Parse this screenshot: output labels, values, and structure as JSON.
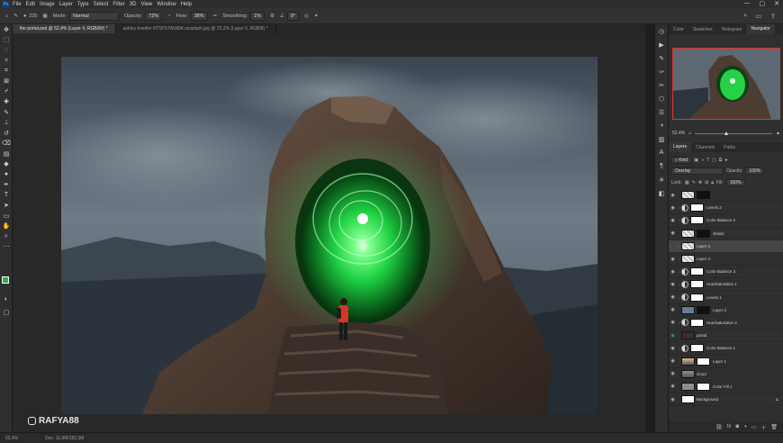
{
  "app": {
    "logo": "Ps"
  },
  "menu": [
    "File",
    "Edit",
    "Image",
    "Layer",
    "Type",
    "Select",
    "Filter",
    "3D",
    "View",
    "Window",
    "Help"
  ],
  "options": {
    "mode_label": "Mode:",
    "mode_value": "Normal",
    "opacity_label": "Opacity:",
    "opacity_value": "72%",
    "flow_label": "Flow:",
    "flow_value": "38%",
    "smoothing_label": "Smoothing:",
    "smoothing_value": "1%",
    "angle_value": "0°",
    "brush_size": "225"
  },
  "tabs": [
    {
      "label": "the portal.psd @ 52,4% (Layer 4, RGB/8#) *",
      "active": true
    },
    {
      "label": "ashley knedler 6TSPSTA5d0A unsplash.jpg @ 22,2% (Layer 0, RGB/8) *",
      "active": false
    }
  ],
  "watermark": {
    "text": "RAFYA88",
    "icon": "instagram-icon"
  },
  "status": {
    "zoom": "52,4%",
    "doc": "Doc: 11,9M/182,3M"
  },
  "panel_tabs": [
    "Color",
    "Swatches",
    "Histogram",
    "Navigator"
  ],
  "panel_tabs_active": "Navigator",
  "navigator": {
    "zoom": "52,4%"
  },
  "layers_tabs": [
    "Layers",
    "Channels",
    "Paths"
  ],
  "layers_tabs_active": "Layers",
  "layers_controls": {
    "kind": "Kind",
    "blend": "Overlay",
    "opacity_label": "Opacity:",
    "opacity_value": "100%",
    "lock_label": "Lock:",
    "fill_label": "Fill:",
    "fill_value": "100%"
  },
  "layers": [
    {
      "name": "",
      "type": "pixel",
      "mask": "dark",
      "eye": true,
      "selected": false
    },
    {
      "name": "Levels 2",
      "type": "adj",
      "mask": "light",
      "eye": true,
      "selected": false
    },
    {
      "name": "Color Balance 2",
      "type": "adj",
      "mask": "light",
      "eye": true,
      "selected": false
    },
    {
      "name": "sfskdz",
      "type": "pixel",
      "mask": "dark",
      "eye": true,
      "selected": false
    },
    {
      "name": "Layer 4",
      "type": "pixel",
      "mask": "",
      "eye": false,
      "selected": true
    },
    {
      "name": "Layer 3",
      "type": "pixel",
      "mask": "",
      "eye": true,
      "selected": false
    },
    {
      "name": "Color Balance 3",
      "type": "adj",
      "mask": "light",
      "eye": true,
      "selected": false
    },
    {
      "name": "Hue/Saturation 1",
      "type": "adj",
      "mask": "light",
      "eye": true,
      "selected": false
    },
    {
      "name": "Levels 1",
      "type": "adj",
      "mask": "light",
      "eye": true,
      "selected": false
    },
    {
      "name": "Layer 2",
      "type": "pixel",
      "mask": "dark",
      "eye": true,
      "selected": false
    },
    {
      "name": "Hue/Saturation 2",
      "type": "adj",
      "mask": "light",
      "eye": true,
      "selected": false
    },
    {
      "name": "portal",
      "type": "pixel",
      "mask": "",
      "eye": true,
      "selected": false
    },
    {
      "name": "Color Balance 1",
      "type": "adj",
      "mask": "light",
      "eye": true,
      "selected": false
    },
    {
      "name": "Layer 1",
      "type": "pixel",
      "mask": "light",
      "eye": true,
      "selected": false
    },
    {
      "name": "cloud",
      "type": "pixel",
      "mask": "",
      "eye": true,
      "selected": false
    },
    {
      "name": "Color Fill 1",
      "type": "fill",
      "mask": "light",
      "eye": true,
      "selected": false
    },
    {
      "name": "Background",
      "type": "pixel",
      "mask": "",
      "eye": true,
      "selected": false,
      "locked": true
    }
  ],
  "colors": {
    "accent": "#2db24a",
    "navigator_frame": "#e0342c",
    "portal_glow": "#3dff6a"
  }
}
